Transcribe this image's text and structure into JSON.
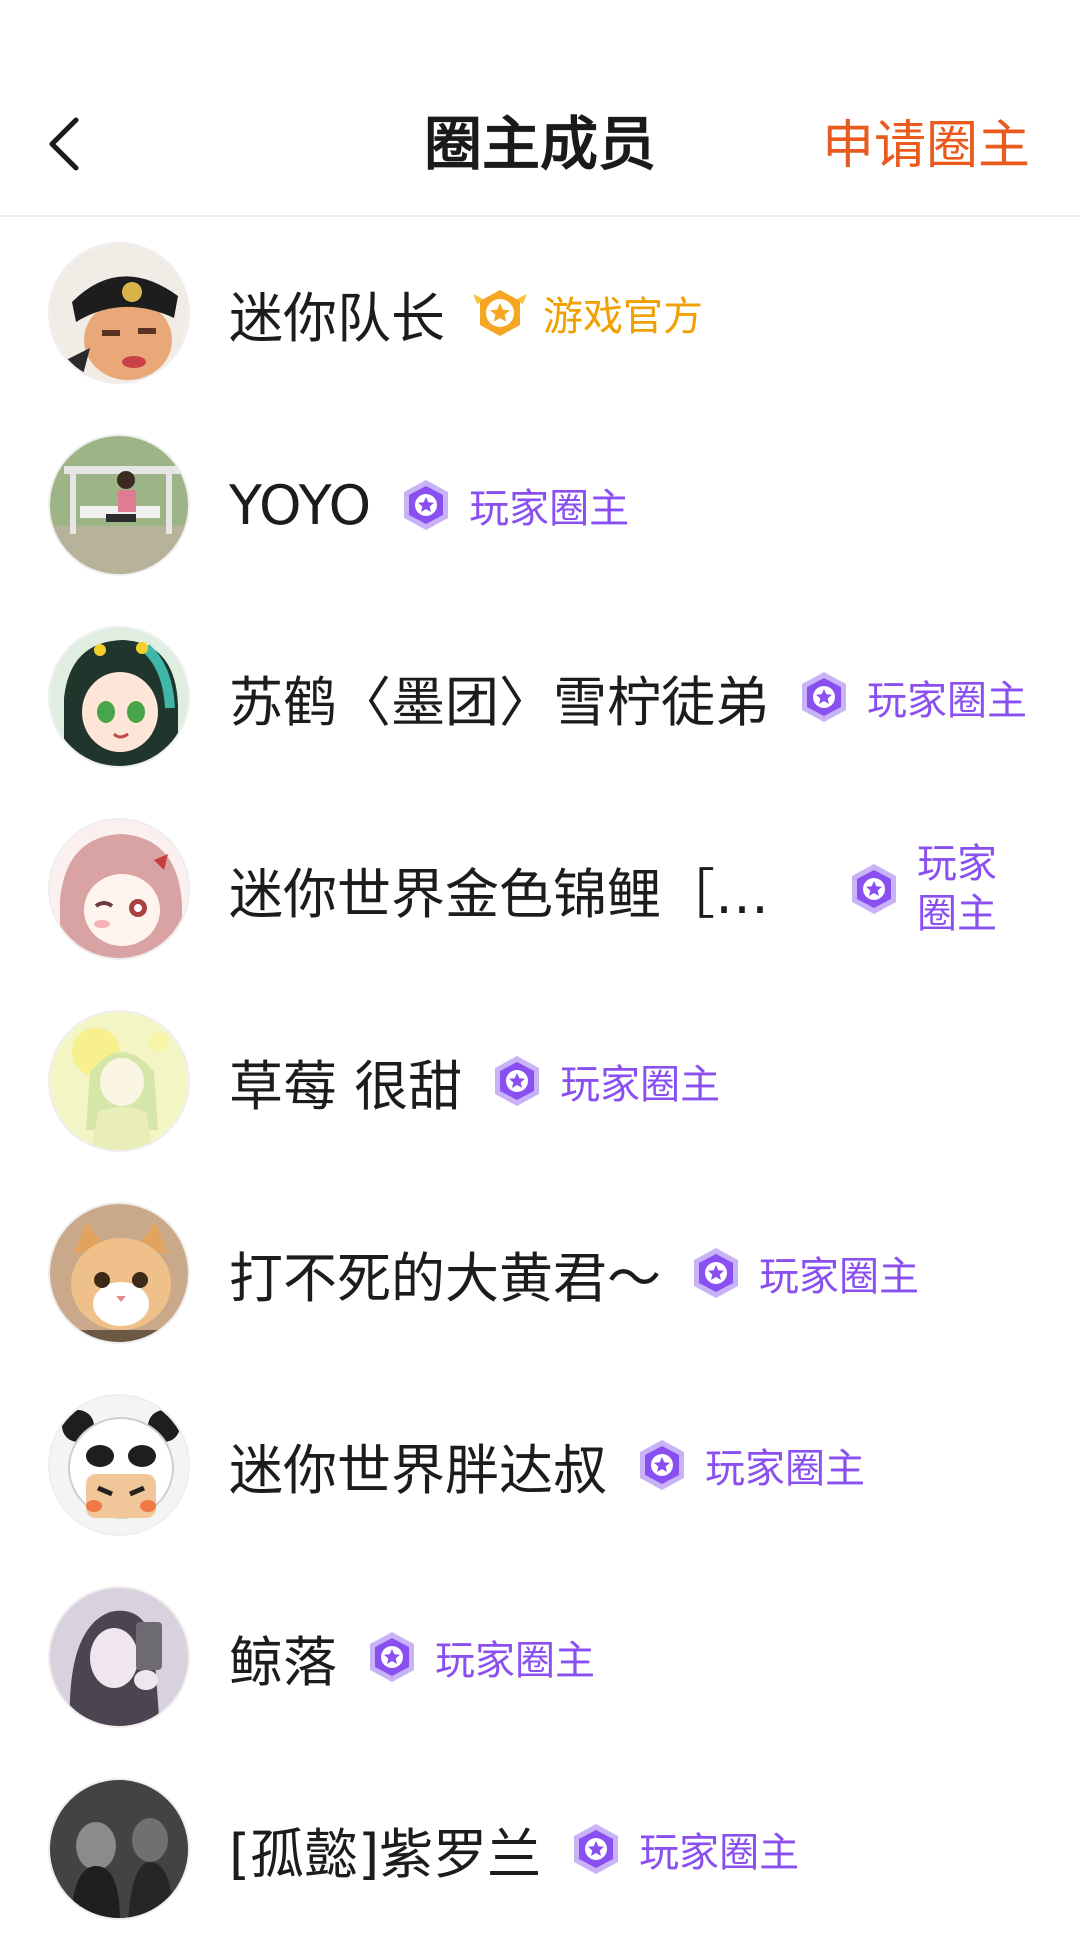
{
  "header": {
    "title": "圈主成员",
    "apply_label": "申请圈主"
  },
  "colors": {
    "accent_orange": "#ea5a1c",
    "official_gold": "#f0a000",
    "player_purple": "#8a4ff0"
  },
  "icons": {
    "back": "chevron-left-icon",
    "official_badge": "gold-star-badge-icon",
    "player_badge": "purple-star-badge-icon"
  },
  "members": [
    {
      "name": "迷你队长",
      "badge": "游戏官方"
    },
    {
      "name": "YOYO",
      "badge": "玩家圈主"
    },
    {
      "name": "苏鹤〈墨团〉雪柠徒弟",
      "badge": "玩家圈主"
    },
    {
      "name": "迷你世界金色锦鲤［星...",
      "badge": "玩家圈主"
    },
    {
      "name": "草莓 很甜",
      "badge": "玩家圈主"
    },
    {
      "name": "打不死的大黄君～",
      "badge": "玩家圈主"
    },
    {
      "name": "迷你世界胖达叔",
      "badge": "玩家圈主"
    },
    {
      "name": "鲸落",
      "badge": "玩家圈主"
    },
    {
      "name": "[孤懿]紫罗兰",
      "badge": "玩家圈主"
    }
  ]
}
